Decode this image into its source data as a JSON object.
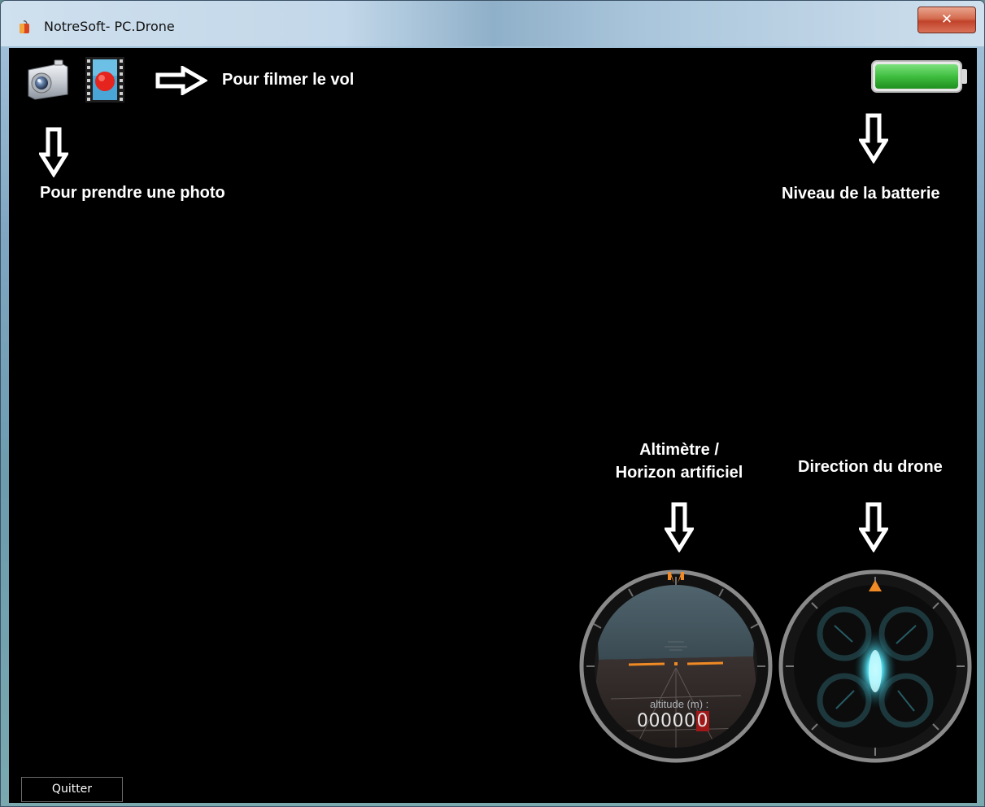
{
  "window": {
    "title": "NotreSoft- PC.Drone",
    "close_icon": "x-icon"
  },
  "toolbar": {
    "photo_icon": "camera-icon",
    "video_icon": "record-film-icon"
  },
  "annotations": {
    "film": "Pour filmer le vol",
    "photo": "Pour prendre une photo",
    "battery": "Niveau de la batterie",
    "altimeter_line1": "Altimètre /",
    "altimeter_line2": "Horizon artificiel",
    "direction": "Direction du drone"
  },
  "battery": {
    "level": 1.0,
    "color": "#3fbe3f"
  },
  "altimeter": {
    "label": "altitude (m) :",
    "value_digits": "00000",
    "value_last": "0",
    "accent": "#f08a24"
  },
  "compass": {
    "accent": "#f08a24",
    "glow": "#4fd6e8"
  },
  "footer": {
    "quit_label": "Quitter"
  }
}
